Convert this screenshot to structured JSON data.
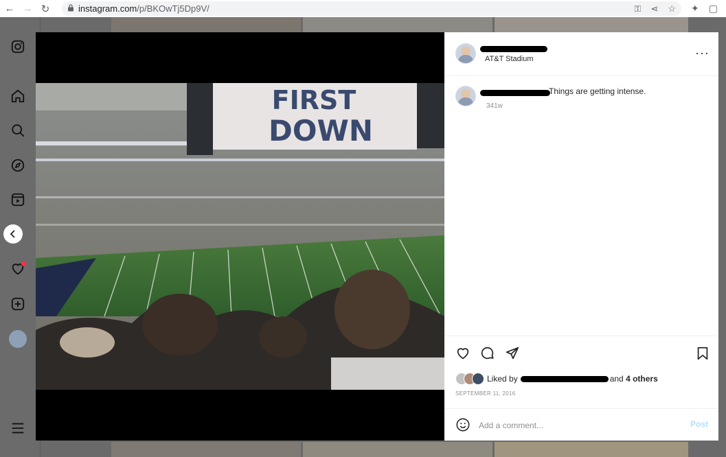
{
  "browser": {
    "url_host": "instagram.com",
    "url_path": "/p/BKOwTj5Dp9V/",
    "back_icon": "arrow-left-icon",
    "forward_icon": "arrow-right-icon",
    "reload_icon": "reload-icon"
  },
  "sidebar": {
    "items": [
      {
        "name": "instagram-logo-icon"
      },
      {
        "name": "home-icon"
      },
      {
        "name": "search-icon"
      },
      {
        "name": "explore-icon"
      },
      {
        "name": "reels-icon"
      },
      {
        "name": "heart-icon"
      },
      {
        "name": "create-icon"
      },
      {
        "name": "profile-avatar"
      },
      {
        "name": "menu-icon"
      }
    ]
  },
  "post": {
    "location": "AT&T Stadium",
    "caption": "Things are getting intense.",
    "time_ago": "341w",
    "liked_prefix": "Liked by",
    "liked_and": "and",
    "liked_others": "4 others",
    "date": "SEPTEMBER 11, 2016",
    "comment_placeholder": "Add a comment...",
    "post_label": "Post",
    "more_label": "···",
    "scoreboard_line1": "FIRST",
    "scoreboard_line2": "DOWN"
  },
  "colors": {
    "notification_dot": "#ff3040",
    "post_button": "#b2dffc",
    "secondary_text": "#8e8e8e"
  }
}
